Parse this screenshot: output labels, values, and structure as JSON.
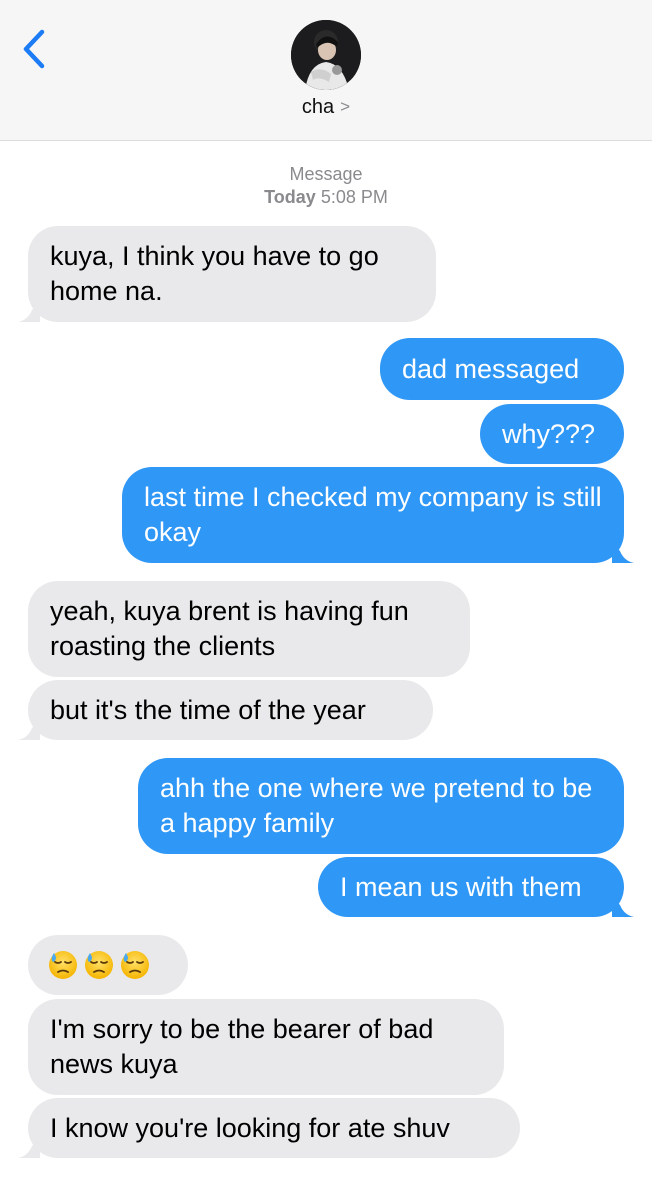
{
  "header": {
    "contact_name": "cha",
    "contact_chevron": ">",
    "back_icon": "chevron-left-icon",
    "avatar_icon": "contact-avatar"
  },
  "thread_meta": {
    "service": "Message",
    "day": "Today",
    "time": "5:08 PM"
  },
  "colors": {
    "incoming": "#e9e9eb",
    "outgoing": "#2f97f6",
    "accent": "#1b7cf5"
  },
  "messages": [
    {
      "from": "them",
      "text": "kuya, I think you have to go home na."
    },
    {
      "from": "me",
      "text": "dad messaged"
    },
    {
      "from": "me",
      "text": "why???"
    },
    {
      "from": "me",
      "text": "last time I checked my company is still okay"
    },
    {
      "from": "them",
      "text": "yeah, kuya brent is having fun roasting the clients"
    },
    {
      "from": "them",
      "text": "but it's the time of the year"
    },
    {
      "from": "me",
      "text": "ahh the one where we pretend to be a happy family"
    },
    {
      "from": "me",
      "text": "I mean us with them"
    },
    {
      "from": "them",
      "emoji": [
        "downcast-sweat-face-icon",
        "downcast-sweat-face-icon",
        "downcast-sweat-face-icon"
      ]
    },
    {
      "from": "them",
      "text": "I'm sorry to be the bearer of bad news kuya"
    },
    {
      "from": "them",
      "text": "I know you're looking for ate shuv"
    }
  ]
}
